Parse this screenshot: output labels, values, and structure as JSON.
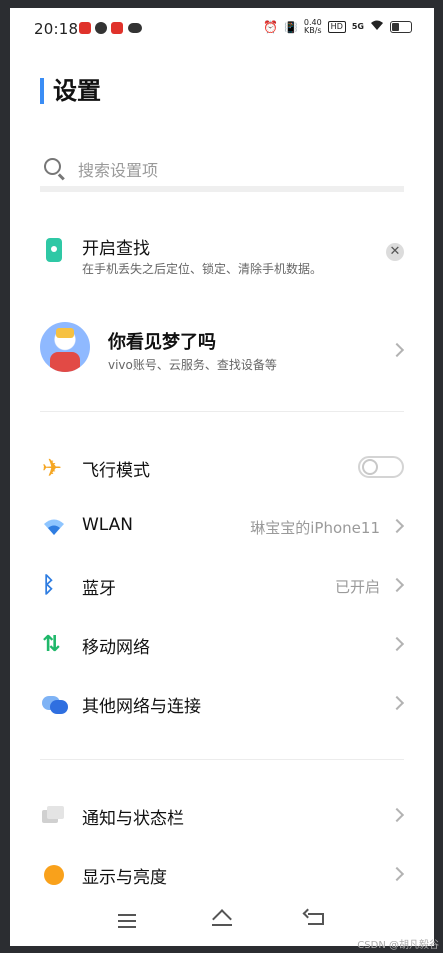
{
  "status_bar": {
    "time": "20:18",
    "net_speed_value": "0.40",
    "net_speed_unit": "KB/s",
    "hd_label": "HD",
    "signal_label": "5G"
  },
  "page": {
    "title": "设置"
  },
  "search": {
    "placeholder": "搜索设置项"
  },
  "find_device": {
    "title": "开启查找",
    "subtitle": "在手机丢失之后定位、锁定、清除手机数据。"
  },
  "account": {
    "name": "你看见梦了吗",
    "subtitle": "vivo账号、云服务、查找设备等"
  },
  "settings": [
    {
      "label": "飞行模式",
      "value": "",
      "toggle": "off"
    },
    {
      "label": "WLAN",
      "value": "琳宝宝的iPhone11"
    },
    {
      "label": "蓝牙",
      "value": "已开启"
    },
    {
      "label": "移动网络",
      "value": ""
    },
    {
      "label": "其他网络与连接",
      "value": ""
    },
    {
      "label": "通知与状态栏",
      "value": ""
    },
    {
      "label": "显示与亮度",
      "value": ""
    }
  ],
  "colors": {
    "accent": "#3a8df5",
    "airplane_icon": "#f5a623",
    "bluetooth_icon": "#2f7de1",
    "mobile_icon": "#1fb86a",
    "display_icon": "#f9a11b",
    "find_icon": "#2fc8a5"
  },
  "watermark": "CSDN @胡凡毅谷"
}
